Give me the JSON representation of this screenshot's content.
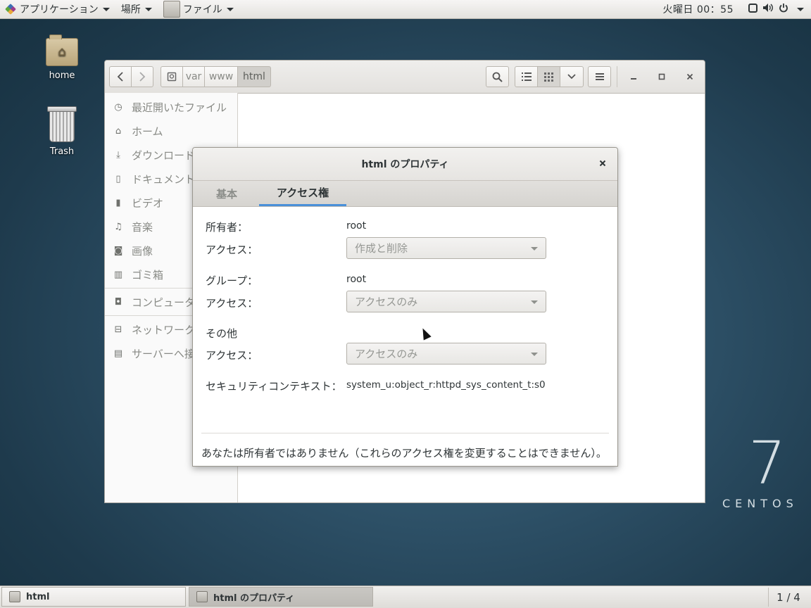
{
  "topbar": {
    "applications": "アプリケーション",
    "places": "場所",
    "files": "ファイル",
    "clock": "火曜日 00：55"
  },
  "desktop": {
    "home_label": "home",
    "trash_label": "Trash",
    "brand_number": "7",
    "brand_word": "CENTOS"
  },
  "fm": {
    "breadcrumbs": [
      "var",
      "www",
      "html"
    ],
    "sidebar": [
      {
        "label": "最近開いたファイル",
        "icon": "clock-icon"
      },
      {
        "label": "ホーム",
        "icon": "home-icon"
      },
      {
        "label": "ダウンロード",
        "icon": "download-icon"
      },
      {
        "label": "ドキュメント",
        "icon": "document-icon"
      },
      {
        "label": "ビデオ",
        "icon": "video-icon"
      },
      {
        "label": "音楽",
        "icon": "music-icon"
      },
      {
        "label": "画像",
        "icon": "camera-icon"
      },
      {
        "label": "ゴミ箱",
        "icon": "trash-icon"
      },
      {
        "label": "コンピューター",
        "icon": "drive-icon"
      },
      {
        "label": "ネットワーク",
        "icon": "network-icon"
      },
      {
        "label": "サーバーへ接続",
        "icon": "server-icon"
      }
    ]
  },
  "dialog": {
    "title": "html のプロパティ",
    "tabs": [
      "基本",
      "アクセス権"
    ],
    "owner_label": "所有者：",
    "owner_value": "root",
    "owner_access_label": "アクセス：",
    "owner_access_value": "作成と削除",
    "group_label": "グループ：",
    "group_value": "root",
    "group_access_label": "アクセス：",
    "group_access_value": "アクセスのみ",
    "others_label": "その他",
    "others_access_label": "アクセス：",
    "others_access_value": "アクセスのみ",
    "context_label": "セキュリティコンテキスト：",
    "context_value": "system_u:object_r:httpd_sys_content_t:s0",
    "note": "あなたは所有者ではありません（これらのアクセス権を変更することはできません）。"
  },
  "taskbar": {
    "task1": "html",
    "task2": "html のプロパティ",
    "pager": "1 / 4"
  },
  "colors": {
    "accent": "#4a90d9",
    "desktop_bg": "#2b4d63"
  }
}
